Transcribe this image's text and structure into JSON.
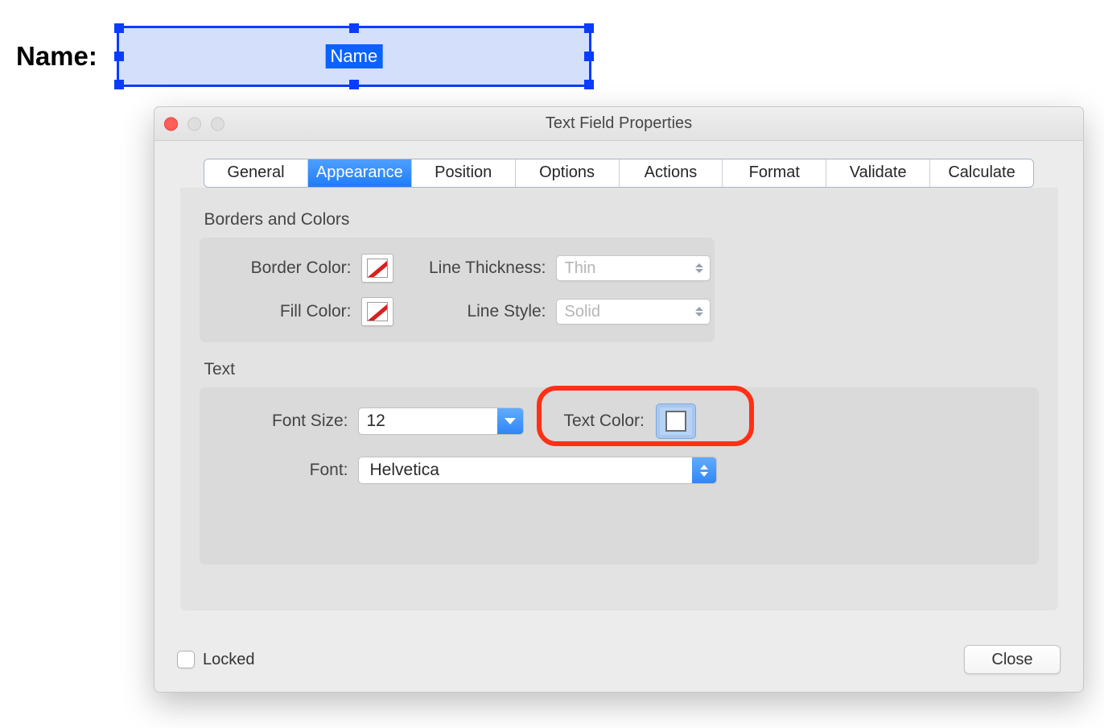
{
  "preview": {
    "outerLabel": "Name:",
    "fieldBadge": "Name"
  },
  "dialog": {
    "title": "Text Field Properties",
    "tabs": {
      "general": "General",
      "appearance": "Appearance",
      "position": "Position",
      "options": "Options",
      "actions": "Actions",
      "format": "Format",
      "validate": "Validate",
      "calculate": "Calculate"
    },
    "sections": {
      "bordersAndColors": {
        "heading": "Borders and Colors",
        "borderColorLabel": "Border Color:",
        "fillColorLabel": "Fill Color:",
        "lineThicknessLabel": "Line Thickness:",
        "lineThicknessValue": "Thin",
        "lineStyleLabel": "Line Style:",
        "lineStyleValue": "Solid"
      },
      "text": {
        "heading": "Text",
        "fontSizeLabel": "Font Size:",
        "fontSizeValue": "12",
        "textColorLabel": "Text Color:",
        "fontLabel": "Font:",
        "fontValue": "Helvetica"
      }
    },
    "footer": {
      "lockedLabel": "Locked",
      "closeLabel": "Close"
    }
  }
}
